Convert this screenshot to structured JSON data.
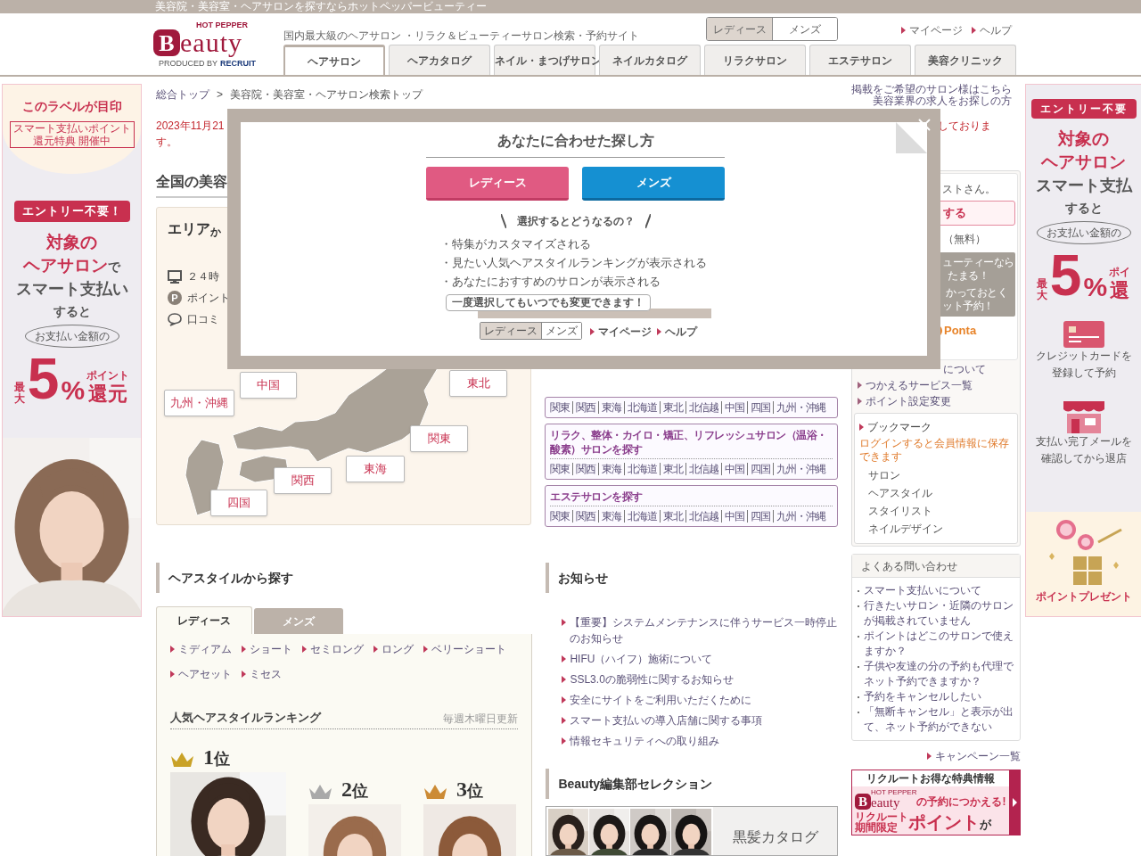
{
  "top_bar": {
    "text": "美容院・美容室・ヘアサロンを探すならホットペッパービューティー"
  },
  "header": {
    "logo": {
      "top": "HOT PEPPER",
      "badge": "B",
      "word": "eauty",
      "credit": "PRODUCED BY",
      "brand": "RECRUIT"
    },
    "tagline": "国内最大級のヘアサロン ・リラク＆ビューティーサロン検索・予約サイト",
    "gender": [
      {
        "label": "レディース",
        "selected": true
      },
      {
        "label": "メンズ",
        "selected": false
      }
    ],
    "links": [
      "マイページ",
      "ヘルプ"
    ],
    "tabs": [
      {
        "label": "ヘアサロン",
        "selected": true
      },
      {
        "label": "ヘアカタログ",
        "selected": false
      },
      {
        "label": "ネイル・まつげサロン",
        "selected": false
      },
      {
        "label": "ネイルカタログ",
        "selected": false
      },
      {
        "label": "リラクサロン",
        "selected": false
      },
      {
        "label": "エステサロン",
        "selected": false
      },
      {
        "label": "美容クリニック",
        "selected": false
      }
    ]
  },
  "left_banner": {
    "label_title": "このラベルが目印",
    "label_tag": "スマート支払いポイント還元特典 開催中",
    "entry": "エントリー不要！",
    "lines": [
      {
        "text": "対象の",
        "kind": "accent"
      },
      {
        "text": "ヘアサロン",
        "suffix": "で",
        "kind": "accent"
      },
      {
        "text": "スマート支払い",
        "kind": "plain"
      },
      {
        "text": "すると",
        "kind": "small"
      }
    ],
    "bubble": "お支払い金額の",
    "max": "最大",
    "number": "5",
    "percent": "%",
    "point": "ポイント",
    "reward": "還元"
  },
  "breadcrumb": {
    "items": [
      "総合トップ",
      "美容院・美容室・ヘアサロン検索トップ"
    ],
    "separator": ">"
  },
  "owner_links": [
    "掲載をご希望のサロン様はこちら",
    "美容業界の求人をお探しの方"
  ],
  "notice": {
    "start": "2023年11月21",
    "end": "しておりま",
    "continuation": "す。"
  },
  "area": {
    "heading": "全国の美容",
    "title": "エリア",
    "title_suffix": "か",
    "features": [
      {
        "kind": "monitor",
        "text": "２４時"
      },
      {
        "kind": "point",
        "badge": "P",
        "text": "ポイント"
      },
      {
        "kind": "comment",
        "text": "口コミ"
      }
    ],
    "regions": [
      "中国",
      "九州・沖縄",
      "東北",
      "関東",
      "東海",
      "関西",
      "四国"
    ]
  },
  "search_boxes": [
    {
      "links": [
        "関東",
        "関西",
        "東海",
        "北海道",
        "東北",
        "北信越",
        "中国",
        "四国",
        "九州・沖縄"
      ]
    },
    {
      "title": "リラク、整体・カイロ・矯正、リフレッシュサロン（温浴・酸素）サロンを探す",
      "links": [
        "関東",
        "関西",
        "東海",
        "北海道",
        "東北",
        "北信越",
        "中国",
        "四国",
        "九州・沖縄"
      ]
    },
    {
      "title": "エステサロンを探す",
      "links": [
        "関東",
        "関西",
        "東海",
        "北海道",
        "東北",
        "北信越",
        "中国",
        "四国",
        "九州・沖縄"
      ]
    }
  ],
  "account": {
    "greeting": "ストさん。",
    "login": "する",
    "register": "（無料）",
    "promo": [
      "ューティーなら",
      "たまる！",
      "かっておとく",
      "ット予約！"
    ],
    "ponta": "Ponta",
    "partial_link": "について",
    "links": [
      "つかえるサービス一覧",
      "ポイント設定変更"
    ]
  },
  "bookmark": {
    "title": "ブックマーク",
    "note": "ログインすると会員情報に保存できます",
    "items": [
      "サロン",
      "ヘアスタイル",
      "スタイリスト",
      "ネイルデザイン"
    ]
  },
  "faq": {
    "title": "よくある問い合わせ",
    "items": [
      "スマート支払いについて",
      "行きたいサロン・近隣のサロンが掲載されていません",
      "ポイントはどこのサロンで使えますか？",
      "子供や友達の分の予約も代理でネット予約できますか？",
      "予約をキャンセルしたい",
      "「無断キャンセル」と表示が出て、ネット予約ができない"
    ]
  },
  "campaign_link": "キャンペーン一覧",
  "promo_banner": {
    "caption": "リクルートお得な特典情報",
    "brand_top": "HOT PEPPER",
    "badge": "B",
    "word": "eauty",
    "line1": "の予約につかえる!",
    "small_top": "リクルート",
    "small_bottom": "期間限定",
    "big": "ポイント",
    "end": "が"
  },
  "hairstyle": {
    "heading": "ヘアスタイルから探す",
    "tabs": [
      {
        "label": "レディース",
        "selected": true
      },
      {
        "label": "メンズ",
        "selected": false
      }
    ],
    "links": [
      "ミディアム",
      "ショート",
      "セミロング",
      "ロング",
      "ベリーショート",
      "ヘアセット",
      "ミセス"
    ],
    "ranking_title": "人気ヘアスタイルランキング",
    "ranking_note": "毎週木曜日更新",
    "ranks": [
      {
        "rank": "1",
        "suffix": "位",
        "color": "#c9a227"
      },
      {
        "rank": "2",
        "suffix": "位",
        "color": "#a9a9a9"
      },
      {
        "rank": "3",
        "suffix": "位",
        "color": "#cc8b35"
      }
    ]
  },
  "news": {
    "heading": "お知らせ",
    "items": [
      "【重要】システムメンテナンスに伴うサービス一時停止のお知らせ",
      "HIFU（ハイフ）施術について",
      "SSL3.0の脆弱性に関するお知らせ",
      "安全にサイトをご利用いただくために",
      "スマート支払いの導入店舗に関する事項",
      "情報セキュリティへの取り組み"
    ]
  },
  "editorial": {
    "heading": "Beauty編集部セレクション",
    "banner_text": "黒髪カタログ"
  },
  "right_banner": {
    "entry": "エントリー不要",
    "lines": [
      {
        "text": "対象の",
        "kind": "accent"
      },
      {
        "text": "ヘアサロン",
        "kind": "accent"
      },
      {
        "text": "スマート支払",
        "kind": "plain"
      },
      {
        "text": "すると",
        "kind": "small"
      }
    ],
    "bubble": "お支払い金額の",
    "max": "最大",
    "number": "5",
    "percent": "%",
    "point": "ポイ",
    "reward": "還",
    "steps": [
      {
        "kind": "card",
        "lines": [
          "クレジットカードを",
          "登録して予約"
        ]
      },
      {
        "kind": "shop",
        "lines": [
          "支払い完了メールを",
          "確認してから退店"
        ]
      },
      {
        "kind": "gift",
        "lines": [
          "ポイントプレゼント"
        ]
      }
    ]
  },
  "modal": {
    "title": "あなたに合わせた探し方",
    "buttons": [
      {
        "label": "レディース",
        "kind": "ladies"
      },
      {
        "label": "メンズ",
        "kind": "mens"
      }
    ],
    "question": "選択するとどうなるの？",
    "benefits": [
      "・特集がカスタマイズされる",
      "・見たい人気ヘアスタイルランキングが表示される",
      "・あなたにおすすめのサロンが表示される"
    ],
    "tip": "一度選択してもいつでも変更できます！",
    "mini_toggle": [
      {
        "label": "レディース",
        "selected": true
      },
      {
        "label": "メンズ",
        "selected": false
      }
    ],
    "mini_links": [
      "マイページ",
      "ヘルプ"
    ]
  }
}
